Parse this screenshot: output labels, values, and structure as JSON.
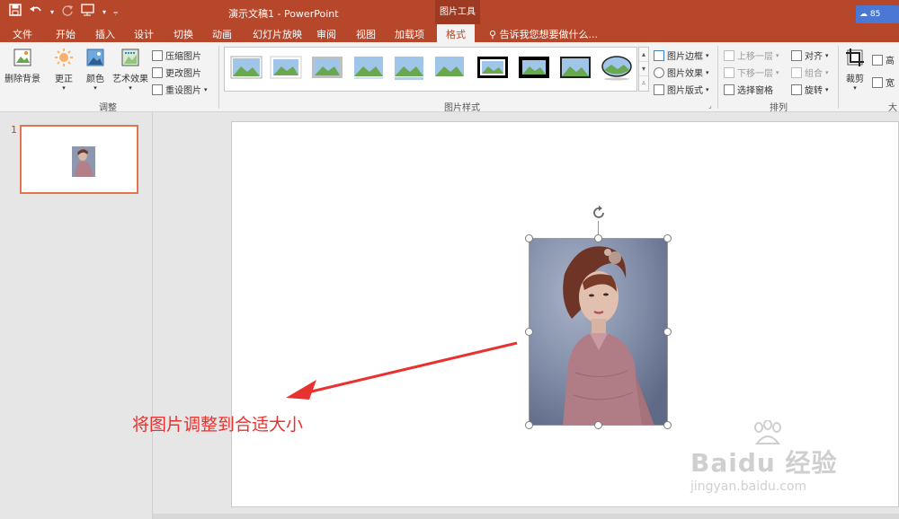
{
  "window": {
    "doc_title": "演示文稿1 - PowerPoint",
    "context_tab_group": "图片工具",
    "account_badge": "85"
  },
  "qat": {
    "save_icon": "save-icon",
    "undo_icon": "undo-icon",
    "redo_icon": "redo-icon",
    "present_icon": "slideshow-from-start-icon",
    "customize_icon": "customize-qat-icon"
  },
  "tabs": [
    {
      "label": "文件"
    },
    {
      "label": "开始"
    },
    {
      "label": "插入"
    },
    {
      "label": "设计"
    },
    {
      "label": "切换"
    },
    {
      "label": "动画"
    },
    {
      "label": "幻灯片放映"
    },
    {
      "label": "审阅"
    },
    {
      "label": "视图"
    },
    {
      "label": "加载项"
    },
    {
      "label": "格式",
      "active": true
    }
  ],
  "tell_me": "告诉我您想要做什么...",
  "ribbon": {
    "adjust": {
      "remove_bg": "删除背景",
      "corrections": "更正",
      "color": "颜色",
      "artistic": "艺术效果",
      "compress": "压缩图片",
      "change": "更改图片",
      "reset": "重设图片",
      "group_label": "调整"
    },
    "styles": {
      "group_label": "图片样式",
      "border": "图片边框",
      "effects": "图片效果",
      "layout": "图片版式"
    },
    "arrange": {
      "bring_forward": "上移一层",
      "send_backward": "下移一层",
      "selection_pane": "选择窗格",
      "align": "对齐",
      "group": "组合",
      "rotate": "旋转",
      "group_label": "排列"
    },
    "size": {
      "crop": "裁剪",
      "height": "高",
      "width": "宽",
      "group_label": "大"
    }
  },
  "thumbnails": [
    {
      "number": "1"
    }
  ],
  "slide": {
    "caption": "将图片调整到合适大小"
  },
  "watermark": {
    "brand": "Baidu 经验",
    "url": "jingyan.baidu.com"
  },
  "colors": {
    "accent": "#b7472a",
    "caption": "#e8322f",
    "thumb_border": "#e1764f"
  }
}
